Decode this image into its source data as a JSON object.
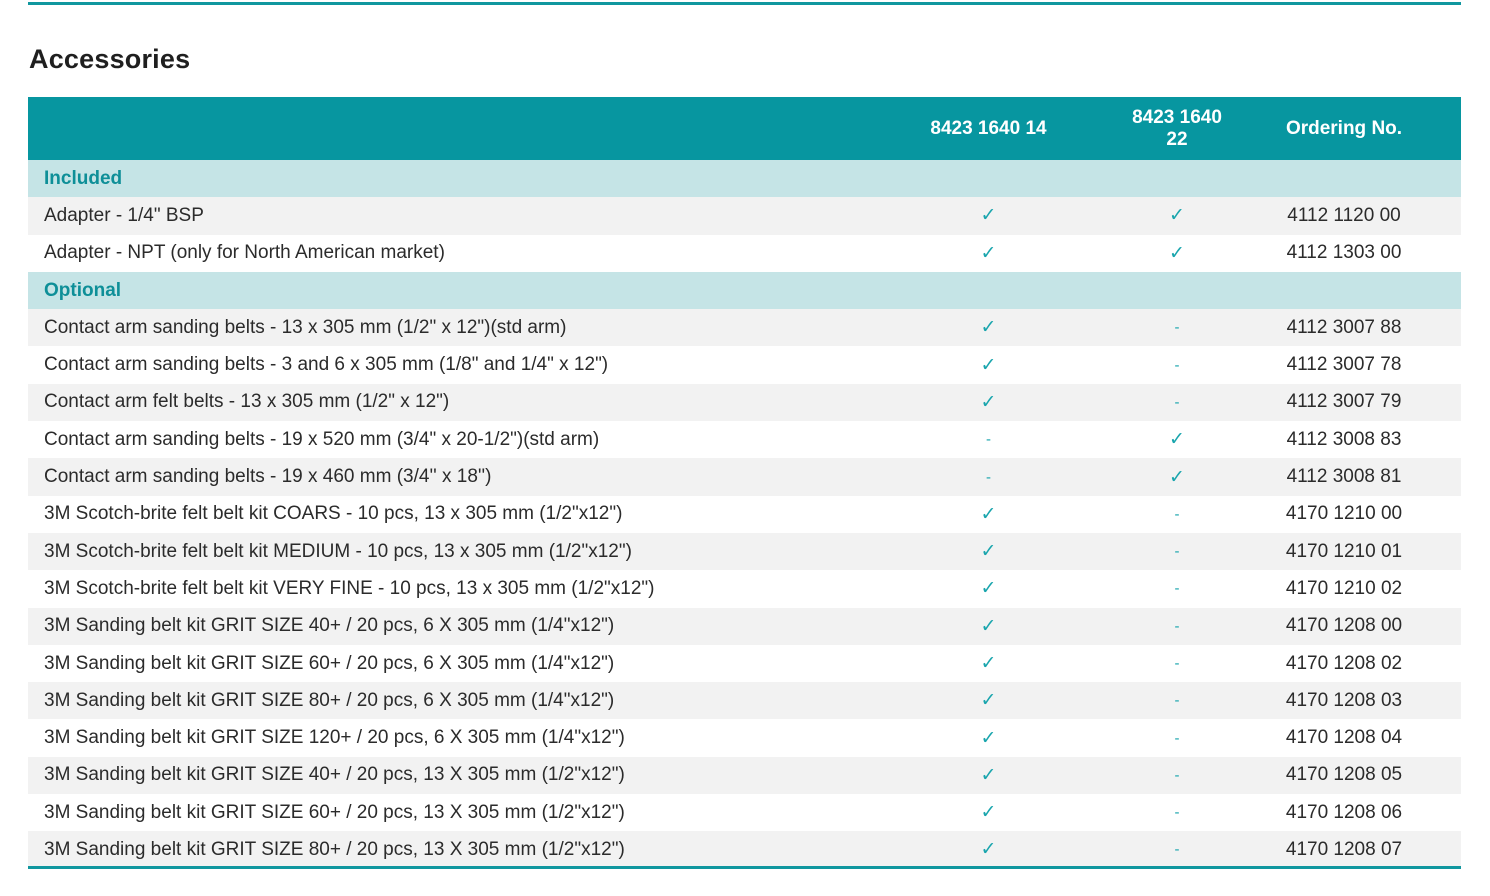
{
  "section_title": "Accessories",
  "table": {
    "headers": [
      "",
      "8423 1640 14",
      "8423 1640 22",
      "Ordering No."
    ],
    "groups": [
      {
        "label": "Included",
        "rows": [
          {
            "desc": "Adapter - 1/4\" BSP",
            "a": "✓",
            "b": "✓",
            "ord": "4112 1120 00"
          },
          {
            "desc": "Adapter - NPT (only for North American market)",
            "a": "✓",
            "b": "✓",
            "ord": "4112 1303 00"
          }
        ]
      },
      {
        "label": "Optional",
        "rows": [
          {
            "desc": "Contact arm sanding belts - 13 x 305 mm (1/2\" x 12\")(std arm)",
            "a": "✓",
            "b": "-",
            "ord": "4112 3007 88"
          },
          {
            "desc": "Contact arm sanding belts - 3 and 6 x 305 mm (1/8\" and 1/4\" x 12\")",
            "a": "✓",
            "b": "-",
            "ord": "4112 3007 78"
          },
          {
            "desc": "Contact arm felt belts - 13 x 305 mm (1/2\" x 12\")",
            "a": "✓",
            "b": "-",
            "ord": "4112 3007 79"
          },
          {
            "desc": "Contact arm sanding belts - 19 x 520 mm (3/4\" x 20-1/2\")(std arm)",
            "a": "-",
            "b": "✓",
            "ord": "4112 3008 83"
          },
          {
            "desc": "Contact arm sanding belts - 19 x 460 mm (3/4'' x 18'')",
            "a": "-",
            "b": "✓",
            "ord": "4112 3008 81"
          },
          {
            "desc": "3M Scotch-brite felt belt kit COARS -  10 pcs, 13 x 305 mm (1/2\"x12\")",
            "a": "✓",
            "b": "-",
            "ord": "4170 1210 00"
          },
          {
            "desc": "3M Scotch-brite felt belt kit MEDIUM -  10 pcs, 13 x 305 mm (1/2\"x12\")",
            "a": "✓",
            "b": "-",
            "ord": "4170 1210 01"
          },
          {
            "desc": "3M Scotch-brite felt belt kit VERY FINE -  10 pcs, 13 x 305 mm (1/2\"x12\")",
            "a": "✓",
            "b": "-",
            "ord": "4170 1210 02"
          },
          {
            "desc": "3M Sanding belt kit GRIT SIZE 40+ / 20 pcs, 6 X 305 mm (1/4\"x12\")",
            "a": "✓",
            "b": "-",
            "ord": "4170 1208 00"
          },
          {
            "desc": "3M Sanding belt kit GRIT SIZE 60+ / 20 pcs, 6 X 305 mm (1/4\"x12\")",
            "a": "✓",
            "b": "-",
            "ord": "4170 1208 02"
          },
          {
            "desc": "3M Sanding belt kit GRIT SIZE 80+ / 20 pcs, 6 X 305 mm (1/4\"x12\")",
            "a": "✓",
            "b": "-",
            "ord": "4170 1208 03"
          },
          {
            "desc": "3M Sanding belt kit GRIT SIZE 120+ / 20 pcs, 6 X 305 mm (1/4\"x12\")",
            "a": "✓",
            "b": "-",
            "ord": "4170 1208 04"
          },
          {
            "desc": "3M Sanding belt kit GRIT SIZE 40+ / 20 pcs, 13 X 305 mm (1/2\"x12\")",
            "a": "✓",
            "b": "-",
            "ord": "4170 1208 05"
          },
          {
            "desc": "3M Sanding belt kit GRIT SIZE 60+ / 20 pcs, 13 X 305 mm (1/2\"x12\")",
            "a": "✓",
            "b": "-",
            "ord": "4170 1208 06"
          },
          {
            "desc": "3M Sanding belt kit GRIT SIZE 80+ / 20 pcs, 13 X 305 mm (1/2\"x12\")",
            "a": "✓",
            "b": "-",
            "ord": "4170 1208 07"
          }
        ]
      }
    ]
  },
  "colors": {
    "header_bg": "#0796a0",
    "group_bg": "#c5e4e6",
    "group_text": "#0e8f98",
    "check": "#19a5ad",
    "row_shade": "#f2f2f2"
  }
}
